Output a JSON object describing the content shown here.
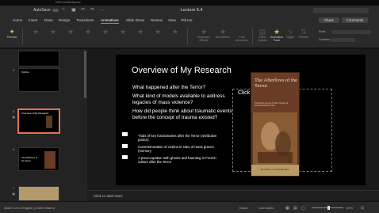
{
  "os_bar": {
    "title": "NSU MediaSpace"
  },
  "titlebar": {
    "autosave_label": "AutoSave",
    "autosave_state": "OFF",
    "window_title": "Lecture 5.4"
  },
  "ribbon_tabs": [
    "Home",
    "Insert",
    "Draw",
    "Design",
    "Transitions",
    "Animations",
    "Slide Show",
    "Review",
    "View",
    "Tell me"
  ],
  "active_tab": "Animations",
  "share_label": "Share",
  "comments_label": "Comments",
  "ribbon": {
    "preview_label": "Preview",
    "effect_options_label": "Effect Options",
    "animation_pane_label": "Animation Pane",
    "trigger_label": "Trigger",
    "reorder_label": "Reorder",
    "start_label": "Start:",
    "duration_label": "Duration:",
    "emphasis_effects_label": "Emphasis Effects",
    "exit_effects_label": "Exit Effects",
    "path_animation_label": "Path Animation"
  },
  "thumbnails": [
    {
      "num": "4",
      "title": "Outline"
    },
    {
      "num": "5",
      "title": "Overview of My Research"
    },
    {
      "num": "6",
      "title": "The Afterlives of the Terror"
    },
    {
      "num": "7",
      "title": ""
    }
  ],
  "slide": {
    "title": "Overview of My Research",
    "questions": [
      "What happened after the Terror?",
      "What kind of models available to address legacies of mass violence?",
      "How did people think about traumatic events before the concept of trauma existed?"
    ],
    "bullets": [
      "Trials of key functionaries after the Terror (retributive justice)",
      "Commemoration of victims in sites of mass graves (memory",
      "A preoccupation with ghosts and haunting in French culture after the Terror"
    ],
    "placeholder": "Click to add text",
    "book": {
      "title": "The Afterlives of the Terror",
      "subtitle": "Facing the Legacies of Mass Violence in Postrevolutionary France",
      "author": "RONEN STEINBERG"
    }
  },
  "notes": {
    "placeholder": "Click to add notes"
  },
  "status": {
    "slide_info": "Slide 5 of 11",
    "language": "English (United States)",
    "notes_label": "Notes",
    "comments_label": "Comments",
    "zoom": "69%"
  },
  "colors": {
    "accent": "#e76f51",
    "ribbon_bg": "#2a2a2a",
    "slide_bg": "#000000"
  }
}
